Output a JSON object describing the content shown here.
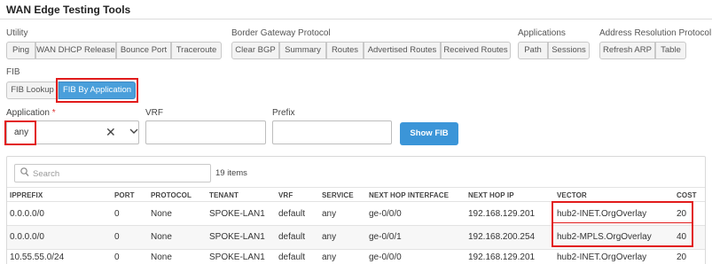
{
  "window": {
    "title": "WAN Edge Testing Tools"
  },
  "groups": [
    {
      "label": "Utility",
      "buttons": [
        "Ping",
        "WAN DHCP Release",
        "Bounce Port",
        "Traceroute"
      ]
    },
    {
      "label": "Border Gateway Protocol",
      "buttons": [
        "Clear BGP",
        "Summary",
        "Routes",
        "Advertised Routes",
        "Received Routes"
      ]
    },
    {
      "label": "Applications",
      "buttons": [
        "Path",
        "Sessions"
      ]
    },
    {
      "label": "Address Resolution Protocol",
      "buttons": [
        "Refresh ARP",
        "Table"
      ]
    },
    {
      "label": "FIB",
      "buttons": [
        "FIB Lookup",
        "FIB By Application"
      ]
    }
  ],
  "form": {
    "application_label": "Application",
    "required_mark": "*",
    "application_value": "any",
    "clear_glyph": "✕",
    "chevron_glyph": "⌄",
    "vrf_label": "VRF",
    "prefix_label": "Prefix",
    "show_button": "Show FIB"
  },
  "table": {
    "search_placeholder": "Search",
    "search_glyph": "⌕",
    "count": "19 items",
    "columns": [
      "IPPREFIX",
      "PORT",
      "PROTOCOL",
      "TENANT",
      "VRF",
      "SERVICE",
      "NEXT HOP INTERFACE",
      "NEXT HOP IP",
      "VECTOR",
      "COST"
    ],
    "rows": [
      [
        "0.0.0.0/0",
        "0",
        "None",
        "SPOKE-LAN1",
        "default",
        "any",
        "ge-0/0/0",
        "192.168.129.201",
        "hub2-INET.OrgOverlay",
        "20"
      ],
      [
        "0.0.0.0/0",
        "0",
        "None",
        "SPOKE-LAN1",
        "default",
        "any",
        "ge-0/0/1",
        "192.168.200.254",
        "hub2-MPLS.OrgOverlay",
        "40"
      ],
      [
        "10.55.55.0/24",
        "0",
        "None",
        "SPOKE-LAN1",
        "default",
        "any",
        "ge-0/0/0",
        "192.168.129.201",
        "hub2-INET.OrgOverlay",
        "20"
      ]
    ]
  },
  "colors": {
    "accent": "#4a9fdb",
    "highlight": "#e21b1b"
  }
}
